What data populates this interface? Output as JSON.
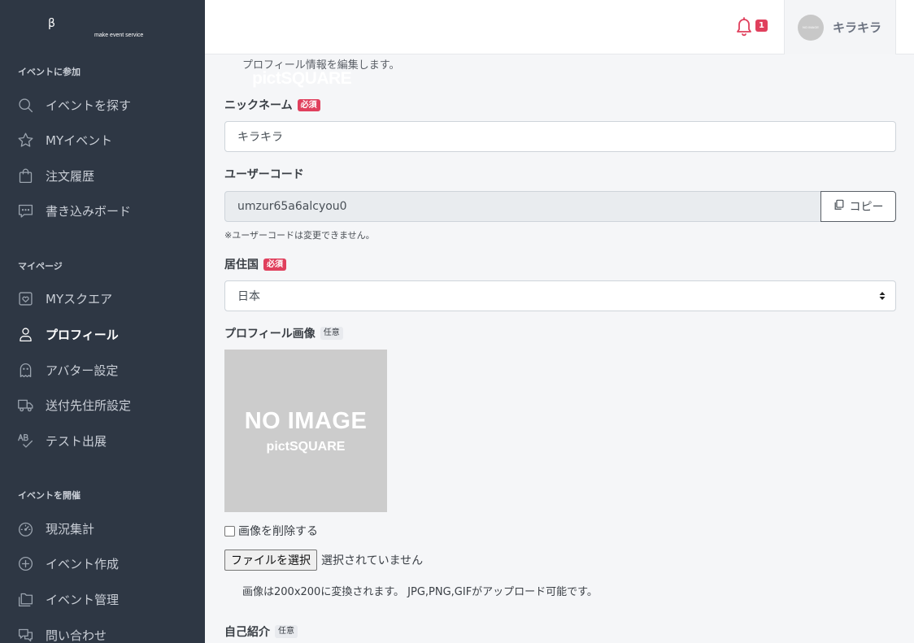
{
  "app": {
    "logo_text": "pictSQUARE",
    "logo_beta": "β",
    "logo_tagline": "make event service"
  },
  "sidebar": {
    "sections": [
      {
        "heading": "イベントに参加",
        "items": [
          {
            "label": "イベントを探す",
            "icon": "search-icon"
          },
          {
            "label": "MYイベント",
            "icon": "star-icon"
          },
          {
            "label": "注文履歴",
            "icon": "shopping-bag-icon"
          },
          {
            "label": "書き込みボード",
            "icon": "chat-icon"
          }
        ]
      },
      {
        "heading": "マイページ",
        "items": [
          {
            "label": "MYスクエア",
            "icon": "square-heart-icon"
          },
          {
            "label": "プロフィール",
            "icon": "user-icon",
            "active": true
          },
          {
            "label": "アバター設定",
            "icon": "ghost-icon"
          },
          {
            "label": "送付先住所設定",
            "icon": "truck-icon"
          },
          {
            "label": "テスト出展",
            "icon": "spell-check-icon"
          }
        ]
      },
      {
        "heading": "イベントを開催",
        "items": [
          {
            "label": "現況集計",
            "icon": "gauge-icon"
          },
          {
            "label": "イベント作成",
            "icon": "plus-circle-icon"
          },
          {
            "label": "イベント管理",
            "icon": "folders-icon"
          },
          {
            "label": "問い合わせ",
            "icon": "chats-icon"
          }
        ]
      }
    ]
  },
  "header": {
    "notification_count": "1",
    "avatar_text": "NO IMAGE",
    "user_name": "キラキラ"
  },
  "form": {
    "description": "プロフィール情報を編集します。",
    "required_badge": "必須",
    "optional_badge": "任意",
    "nickname": {
      "label": "ニックネーム",
      "value": "キラキラ"
    },
    "user_code": {
      "label": "ユーザーコード",
      "value": "umzur65a6alcyou0",
      "copy_label": "コピー",
      "note": "※ユーザーコードは変更できません。"
    },
    "country": {
      "label": "居住国",
      "value": "日本"
    },
    "profile_image": {
      "label": "プロフィール画像",
      "placeholder_title": "NO IMAGE",
      "placeholder_sub": "pictSQUARE",
      "delete_label": "画像を削除する",
      "file_button": "ファイルを選択",
      "file_status": "選択されていません",
      "hint": "画像は200x200に変換されます。 JPG,PNG,GIFがアップロード可能です。"
    },
    "bio": {
      "label": "自己紹介"
    }
  },
  "colors": {
    "sidebar_bg": "#2e3744",
    "accent": "#e0405d"
  }
}
